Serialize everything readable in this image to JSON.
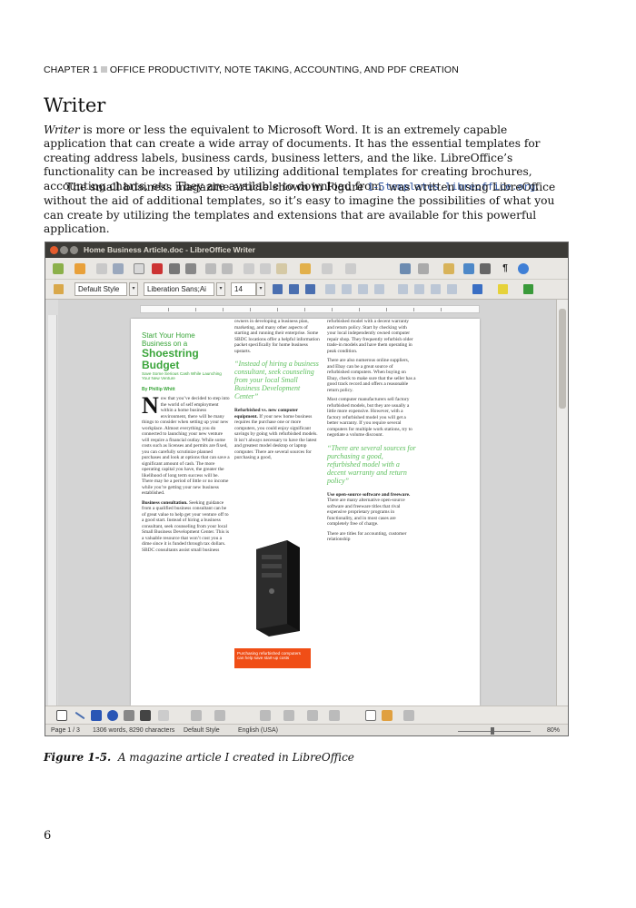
{
  "header": {
    "chapter": "CHAPTER 1",
    "title": "OFFICE PRODUCTIVITY, NOTE TAKING, ACCOUNTING, AND PDF CREATION"
  },
  "section_title": "Writer",
  "paragraph1": {
    "lead": "Writer",
    "text": " is more or less the equivalent to Microsoft Word. It is an extremely capable application that can create a wide array of documents. It has the essential templates for creating address labels, business cards, business letters, and the like. LibreOffice’s functionality can be increased by utilizing additional templates for creating brochures, accounting charts, etc. They are available to download from ",
    "url": "templates.libreoffice.org",
    "end": "."
  },
  "paragraph2": {
    "before": "The small business magazine article shown in Figure ",
    "fig_ref": "1-5",
    "after": " was written using LibreOffice without the aid of additional templates, so it’s easy to imagine the possibilities of what you can create by utilizing the templates and extensions that are available for this powerful application."
  },
  "screenshot": {
    "window_title": "Home Business Article.doc - LibreOffice Writer",
    "paragraph_style": "Default Style",
    "font_name": "Liberation Sans;Ai",
    "font_size": "14",
    "status": {
      "page": "Page 1 / 3",
      "words": "1306 words, 8290 characters",
      "style": "Default Style",
      "language": "English (USA)",
      "zoom": "80%"
    },
    "article": {
      "headline_small_1": "Start Your Home",
      "headline_small_2": "Business on a",
      "headline_big_1": "Shoestring",
      "headline_big_2": "Budget",
      "subhead": "Save Some Serious Cash While Launching Your New Venture",
      "byline": "By Phillip Whitt",
      "dropcap": "N",
      "col1_intro": "ow that you’ve decided to step into the world of self employment within a home business environment, there will be many things to consider when setting up your new workplace. Almost everything you do connected to launching your new venture will require a financial outlay. While some costs such as licenses and permits are fixed, you can carefully scrutinize planned purchases and look at options that can save a significant amount of cash. The more operating capital you have, the greater the likelihood of long term success will be. There may be a period of little or no income while you’re getting your new business established.",
      "col1_head": "Business consultation.",
      "col1_text": " Seeking guidance from a qualified business consultant can be of great value to help get your venture off to a good start. Instead of hiring a business consultant, seek counseling from your local Small Business Development Center. This is a valuable resource that won’t cost you a dime since it is funded through tax dollars. SBDC consultants assist small business",
      "col2_top": "owners in developing a business plan, marketing, and many other aspects of starting and running their enterprise. Some SBDC locations offer a helpful information packet specifically for home business upstarts.",
      "pull1": "“Instead of hiring a business consultant, seek counseling from your local Small Business Development Center”",
      "col2_head": "Refurbished vs. new computer equipment.",
      "col2_text": " If your new home business requires the purchase one or more computers, you could enjoy significant savings by going with refurbished models. It isn’t always necessary to have the latest and greatest model desktop or laptop computer. There are several sources for purchasing a good,",
      "orange_caption": "Purchasing refurbished computers can help save start-up costs",
      "col3_top": "refurbished model with a decent warranty and return policy. Start by checking with your local independently owned computer repair shop. They frequently refurbish older trade-in models and have them operating in peak condition.",
      "col3_p2": "There are also numerous online suppliers, and Ebay can be a great source of refurbished computers. When buying on Ebay, check to make sure that the seller has a good track record and offers a reasonable return policy.",
      "col3_p3": "Most computer manufacturers sell factory refurbished models, but they are usually a little more expensive. However, with a factory refurbished model you will get a better warranty. If you require several computers for multiple work stations, try to negotiate a volume discount.",
      "pull2": "“There are several sources for purchasing a good, refurbished model with a decent warranty and return policy”",
      "col3_head": "Use open-source software and freeware.",
      "col3_text": " There are many alternative open-source software and freeware titles that rival expensive proprietary programs in functionality, and in most cases are completely free of charge.",
      "col3_end": "There are titles for accounting, customer relationship"
    }
  },
  "caption": {
    "label": "Figure 1-5.",
    "text": "A magazine article I created in LibreOffice"
  },
  "page_number": "6",
  "colors": {
    "link": "#2a4f9c",
    "article_green": "#3aa53a",
    "orange": "#f04e16",
    "titlebar": "#3c3b37"
  }
}
